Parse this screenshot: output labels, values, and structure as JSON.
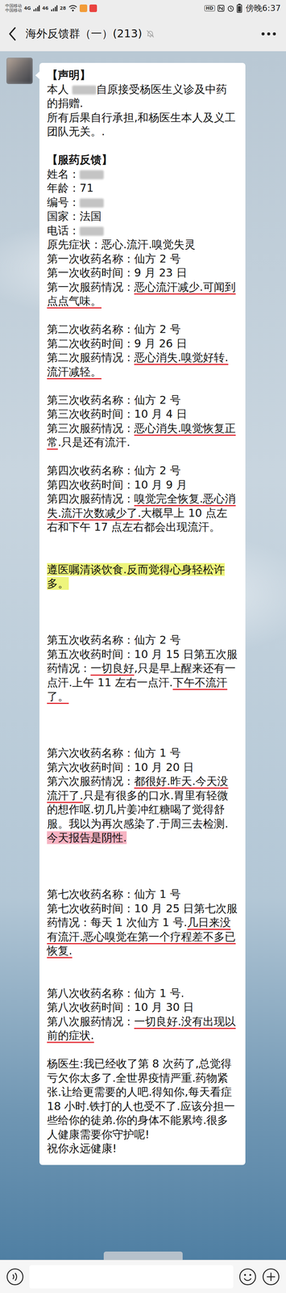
{
  "status_bar": {
    "carriers": [
      "中国移动",
      "中国移动"
    ],
    "network": "4G",
    "signal_label": "46",
    "speed": "28",
    "notification_icons": [
      {
        "color": "#f29b38"
      },
      {
        "color": "#e9433f"
      }
    ],
    "hd": "HD",
    "time": "傍晚6:37"
  },
  "header": {
    "title": "海外反馈群（一）(213)",
    "muted": true
  },
  "message": {
    "avatar_redacted": true,
    "lines": [
      [
        {
          "text": "【声明】",
          "mark": "bold"
        }
      ],
      [
        {
          "text": "本人 ",
          "mark": "plain"
        },
        {
          "text": "",
          "mark": "redacted"
        },
        {
          "text": "自原接受杨医生义诊及中药的捐赠.",
          "mark": "plain"
        }
      ],
      [
        {
          "text": "所有后果自行承担,和杨医生本人及义工团队无关。.",
          "mark": "plain"
        }
      ],
      [],
      [
        {
          "text": "【服药反馈】",
          "mark": "bold"
        }
      ],
      [
        {
          "text": "姓名：",
          "mark": "plain"
        },
        {
          "text": "",
          "mark": "redacted"
        }
      ],
      [
        {
          "text": "年龄：71",
          "mark": "plain"
        }
      ],
      [
        {
          "text": "编号：",
          "mark": "plain"
        },
        {
          "text": "",
          "mark": "redacted"
        }
      ],
      [
        {
          "text": "国家：法国",
          "mark": "plain"
        }
      ],
      [
        {
          "text": "电话：",
          "mark": "plain"
        },
        {
          "text": "",
          "mark": "redacted"
        }
      ],
      [
        {
          "text": "原先症状：恶心.流汗.嗅觉失灵",
          "mark": "plain"
        }
      ],
      [
        {
          "text": "第一次收药名称：仙方 2 号",
          "mark": "plain"
        }
      ],
      [
        {
          "text": "第一次收药时间：9 月 23 日",
          "mark": "plain"
        }
      ],
      [
        {
          "text": "第一次服药情况：",
          "mark": "plain"
        },
        {
          "text": "恶心流汗减少.可闻到点点气味。",
          "mark": "underline"
        }
      ],
      [],
      [
        {
          "text": "第二次收药名称：仙方 2 号",
          "mark": "plain"
        }
      ],
      [
        {
          "text": "第二次收药时间：9 月 26 日",
          "mark": "plain"
        }
      ],
      [
        {
          "text": "第二次服药情况：",
          "mark": "plain"
        },
        {
          "text": "恶心消失.嗅觉好转.流汗减轻。",
          "mark": "underline"
        }
      ],
      [],
      [
        {
          "text": "第三次收药名称：仙方 2 号",
          "mark": "plain"
        }
      ],
      [
        {
          "text": "第三次收药时间：10 月 4 日",
          "mark": "plain"
        }
      ],
      [
        {
          "text": "第三次服药情况：",
          "mark": "plain"
        },
        {
          "text": "恶心消失.嗅觉恢复正常",
          "mark": "underline"
        },
        {
          "text": ".只是还有流汗.",
          "mark": "plain"
        }
      ],
      [],
      [
        {
          "text": "第四次收药名称：仙方 2 号",
          "mark": "plain"
        }
      ],
      [
        {
          "text": "第四次收药时间：10 月 9 月",
          "mark": "plain"
        }
      ],
      [
        {
          "text": "第四次服药情况：",
          "mark": "plain"
        },
        {
          "text": "嗅觉完全恢复.恶心消失.流汗次数减少了.",
          "mark": "underline"
        },
        {
          "text": "大概早上 10 点左右和下午 17 点左右都会出现流汗。",
          "mark": "plain"
        }
      ],
      [],
      [],
      [
        {
          "text": "遵医嘱清谈饮食.反而觉得心身轻松许多。",
          "mark": "highlight"
        }
      ],
      [],
      [],
      [],
      [
        {
          "text": "第五次收药名称：仙方 2 号",
          "mark": "plain"
        }
      ],
      [
        {
          "text": "第五次收药时间：10 月 15 日第五次服药情况：",
          "mark": "plain"
        },
        {
          "text": "一切良好",
          "mark": "underline"
        },
        {
          "text": ",只是早上醒来还有一点汗.上午 11 左右一点汗.",
          "mark": "plain"
        },
        {
          "text": "下午不流汗了。",
          "mark": "underline"
        }
      ],
      [],
      [],
      [],
      [
        {
          "text": "第六次收药名称：仙方 1 号",
          "mark": "plain"
        }
      ],
      [
        {
          "text": "第六次收药时间：10 月 20 日",
          "mark": "plain"
        }
      ],
      [
        {
          "text": "第六次服药情况：",
          "mark": "plain"
        },
        {
          "text": "都很好.昨天.今天没流汗了.",
          "mark": "underline"
        },
        {
          "text": "只是有很多的口水.胃里有轻微的想作呕.切几片姜冲红糖喝了觉得舒服。我以为再次感染了.于周三去检测.",
          "mark": "plain"
        },
        {
          "text": "今天报告是阴性.",
          "mark": "alert"
        }
      ],
      [],
      [],
      [],
      [
        {
          "text": "第七次收药名称：仙方 1 号",
          "mark": "plain"
        }
      ],
      [
        {
          "text": "第七次收药时间：10 月 25 日第七次服药情况：每天 1 次仙方 1 号.",
          "mark": "plain"
        },
        {
          "text": "几日来没有流汗.恶心嗅觉在第一个疗程差不多已恢复.",
          "mark": "underline"
        }
      ],
      [],
      [],
      [
        {
          "text": "第八次收药名称：仙方 1 号.",
          "mark": "plain"
        }
      ],
      [
        {
          "text": "第八次收药时间：10 月 30 日",
          "mark": "plain"
        }
      ],
      [
        {
          "text": "第八次服药情况：",
          "mark": "plain"
        },
        {
          "text": "一切良好.没有出现以前的症状.",
          "mark": "underline"
        }
      ],
      [],
      [
        {
          "text": "杨医生:我已经收了第 8 次药了,总觉得亏欠你太多了.全世界疫情严重.药物紧张.让给更需要的人吧.得知你,每天看症 18 小时.铁打的人也受不了.应该分担一些给你的徒弟.你的身体不能累垮.很多人健康需要你守护呢!",
          "mark": "plain"
        }
      ],
      [
        {
          "text": "祝你永远健康!",
          "mark": "plain"
        }
      ]
    ]
  },
  "time_divider": {
    "visible": true,
    "cut_off": true
  },
  "input_bar": {
    "value": ""
  }
}
